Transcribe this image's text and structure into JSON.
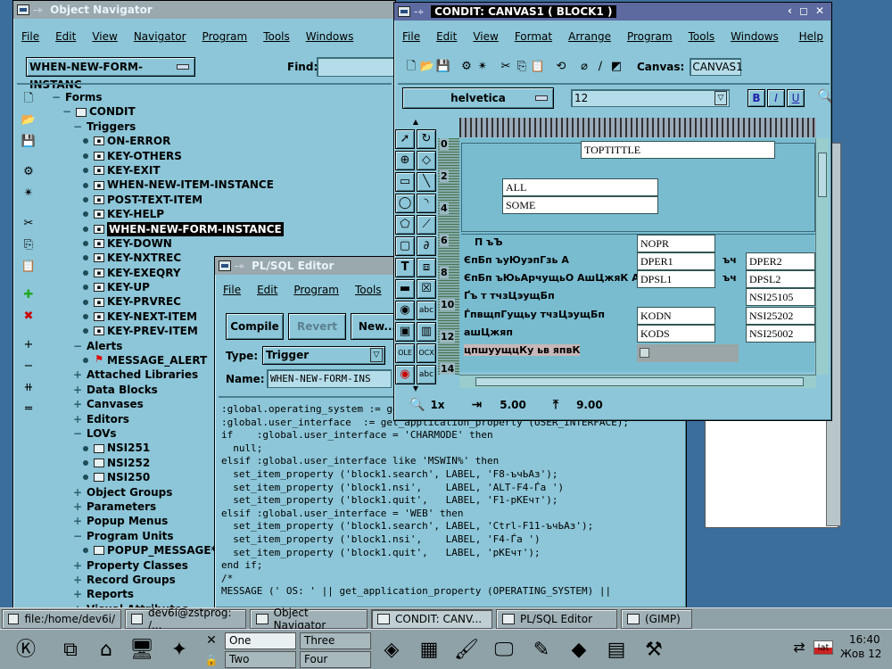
{
  "navigator": {
    "title": "Object Navigator",
    "menu": [
      "File",
      "Edit",
      "View",
      "Navigator",
      "Program",
      "Tools",
      "Windows"
    ],
    "location_value": "WHEN-NEW-FORM-INSTANC",
    "find_label": "Find:",
    "tree": [
      {
        "text": "Forms",
        "lvl": 0,
        "sym": "−"
      },
      {
        "text": "CONDIT",
        "lvl": 1,
        "sym": "−",
        "icon": "form"
      },
      {
        "text": "Triggers",
        "lvl": 2,
        "sym": "−"
      },
      {
        "text": "ON-ERROR",
        "lvl": 3,
        "icon": "trg"
      },
      {
        "text": "KEY-OTHERS",
        "lvl": 3,
        "icon": "trg"
      },
      {
        "text": "KEY-EXIT",
        "lvl": 3,
        "icon": "trg"
      },
      {
        "text": "WHEN-NEW-ITEM-INSTANCE",
        "lvl": 3,
        "icon": "trg"
      },
      {
        "text": "POST-TEXT-ITEM",
        "lvl": 3,
        "icon": "trg"
      },
      {
        "text": "KEY-HELP",
        "lvl": 3,
        "icon": "trg"
      },
      {
        "text": "WHEN-NEW-FORM-INSTANCE",
        "lvl": 3,
        "icon": "trg",
        "selected": true
      },
      {
        "text": "KEY-DOWN",
        "lvl": 3,
        "icon": "trg"
      },
      {
        "text": "KEY-NXTREC",
        "lvl": 3,
        "icon": "trg"
      },
      {
        "text": "KEY-EXEQRY",
        "lvl": 3,
        "icon": "trg"
      },
      {
        "text": "KEY-UP",
        "lvl": 3,
        "icon": "trg"
      },
      {
        "text": "KEY-PRVREC",
        "lvl": 3,
        "icon": "trg"
      },
      {
        "text": "KEY-NEXT-ITEM",
        "lvl": 3,
        "icon": "trg"
      },
      {
        "text": "KEY-PREV-ITEM",
        "lvl": 3,
        "icon": "trg"
      },
      {
        "text": "Alerts",
        "lvl": 2,
        "sym": "−"
      },
      {
        "text": "MESSAGE_ALERT",
        "lvl": 3,
        "icon": "flag"
      },
      {
        "text": "Attached Libraries",
        "lvl": 2,
        "sym": "+"
      },
      {
        "text": "Data Blocks",
        "lvl": 2,
        "sym": "+"
      },
      {
        "text": "Canvases",
        "lvl": 2,
        "sym": "+"
      },
      {
        "text": "Editors",
        "lvl": 2,
        "sym": "+"
      },
      {
        "text": "LOVs",
        "lvl": 2,
        "sym": "−"
      },
      {
        "text": "NSI251",
        "lvl": 3,
        "icon": "lov"
      },
      {
        "text": "NSI252",
        "lvl": 3,
        "icon": "lov"
      },
      {
        "text": "NSI250",
        "lvl": 3,
        "icon": "lov"
      },
      {
        "text": "Object Groups",
        "lvl": 2,
        "sym": "+"
      },
      {
        "text": "Parameters",
        "lvl": 2,
        "sym": "+"
      },
      {
        "text": "Popup Menus",
        "lvl": 2,
        "sym": "+"
      },
      {
        "text": "Program Units",
        "lvl": 2,
        "sym": "−"
      },
      {
        "text": "POPUP_MESSAGE* (I",
        "lvl": 3,
        "icon": "doc"
      },
      {
        "text": "Property Classes",
        "lvl": 2,
        "sym": "+"
      },
      {
        "text": "Record Groups",
        "lvl": 2,
        "sym": "+"
      },
      {
        "text": "Reports",
        "lvl": 2,
        "sym": "+"
      },
      {
        "text": "Visual Attributes",
        "lvl": 2,
        "sym": "+"
      }
    ]
  },
  "plsql": {
    "title": "PL/SQL Editor",
    "menu": [
      "File",
      "Edit",
      "Program",
      "Tools"
    ],
    "compile_label": "Compile",
    "revert_label": "Revert",
    "new_label": "New...",
    "type_label": "Type:",
    "type_value": "Trigger",
    "name_label": "Name:",
    "name_value": "WHEN-NEW-FORM-INS",
    "code": ":global.operating_system := get_application_property (OPERATING_SYSTEM);\n:global.user_interface  := get_application_property (USER_INTERFACE);\nif    :global.user_interface = 'CHARMODE' then\n  null;\nelsif :global.user_interface like 'MSWIN%' then\n  set_item_property ('block1.search', LABEL, 'F8-ъчЬАз');\n  set_item_property ('block1.nsi',    LABEL, 'ALT-F4-Ѓа ')\n  set_item_property ('block1.quit',   LABEL, 'F1-рКЕчт');\nelsif :global.user_interface = 'WEB' then\n  set_item_property ('block1.search', LABEL, 'Ctrl-F11-ъчЬАз');\n  set_item_property ('block1.nsi',    LABEL, 'F4-Ѓа ')\n  set_item_property ('block1.quit',   LABEL, 'рКЕчт');\nend if;\n/*\nMESSAGE (' OS: ' || get_application_property (OPERATING_SYSTEM) ||"
  },
  "condit": {
    "title": "CONDIT: CANVAS1 ( BLOCK1 )",
    "menu": [
      "File",
      "Edit",
      "View",
      "Format",
      "Arrange",
      "Program",
      "Tools",
      "Windows",
      "Help"
    ],
    "canvas_label": "Canvas:",
    "canvas_value": "CANVAS1",
    "font_name": "helvetica",
    "font_size": "12",
    "ruler_marks": [
      "0",
      "2",
      "4",
      "6",
      "8",
      "10",
      "12",
      "14"
    ],
    "fields": {
      "toptitle": "TOPTITTLE",
      "all": "ALL",
      "some": "SOME",
      "nopr": "NOPR",
      "dper1": "DPER1",
      "dper2": "DPER2",
      "dpsl1": "DPSL1",
      "dpsl2": "DPSL2",
      "nsi25105": "NSI25105",
      "kodn": "KODN",
      "nsi25202": "NSI25202",
      "kods": "KODS",
      "nsi25002": "NSI25002"
    },
    "labels": {
      "l1": "П ъЪ",
      "l2": "ЄпБп ъуЮуэпГзь А",
      "l3": "ЄпБп ъЮьАрчущьО АшЦжяК А",
      "l4": "Ґъ т тчзЦэущБп",
      "l5": "ЃпвщпГущьу тчзЦэущБп",
      "l6": "ашЦжяп",
      "l7": "цпшуущцКу ьв япвК",
      "to1": "ъч",
      "to2": "ъч"
    },
    "status": {
      "zoom": "1x",
      "x": "5.00",
      "y": "9.00"
    }
  },
  "taskbar": {
    "tasks": [
      {
        "label": "file:/home/dev6i/"
      },
      {
        "label": "dev6i@zstprog: /..."
      },
      {
        "label": "Object Navigator"
      },
      {
        "label": "CONDIT: CANV..."
      },
      {
        "label": "PL/SQL Editor"
      },
      {
        "label": "(GIMP)"
      }
    ],
    "desktops": [
      "One",
      "Three",
      "Two",
      "Four"
    ],
    "lang": "lat",
    "time": "16:40",
    "date": "Жов 12"
  }
}
